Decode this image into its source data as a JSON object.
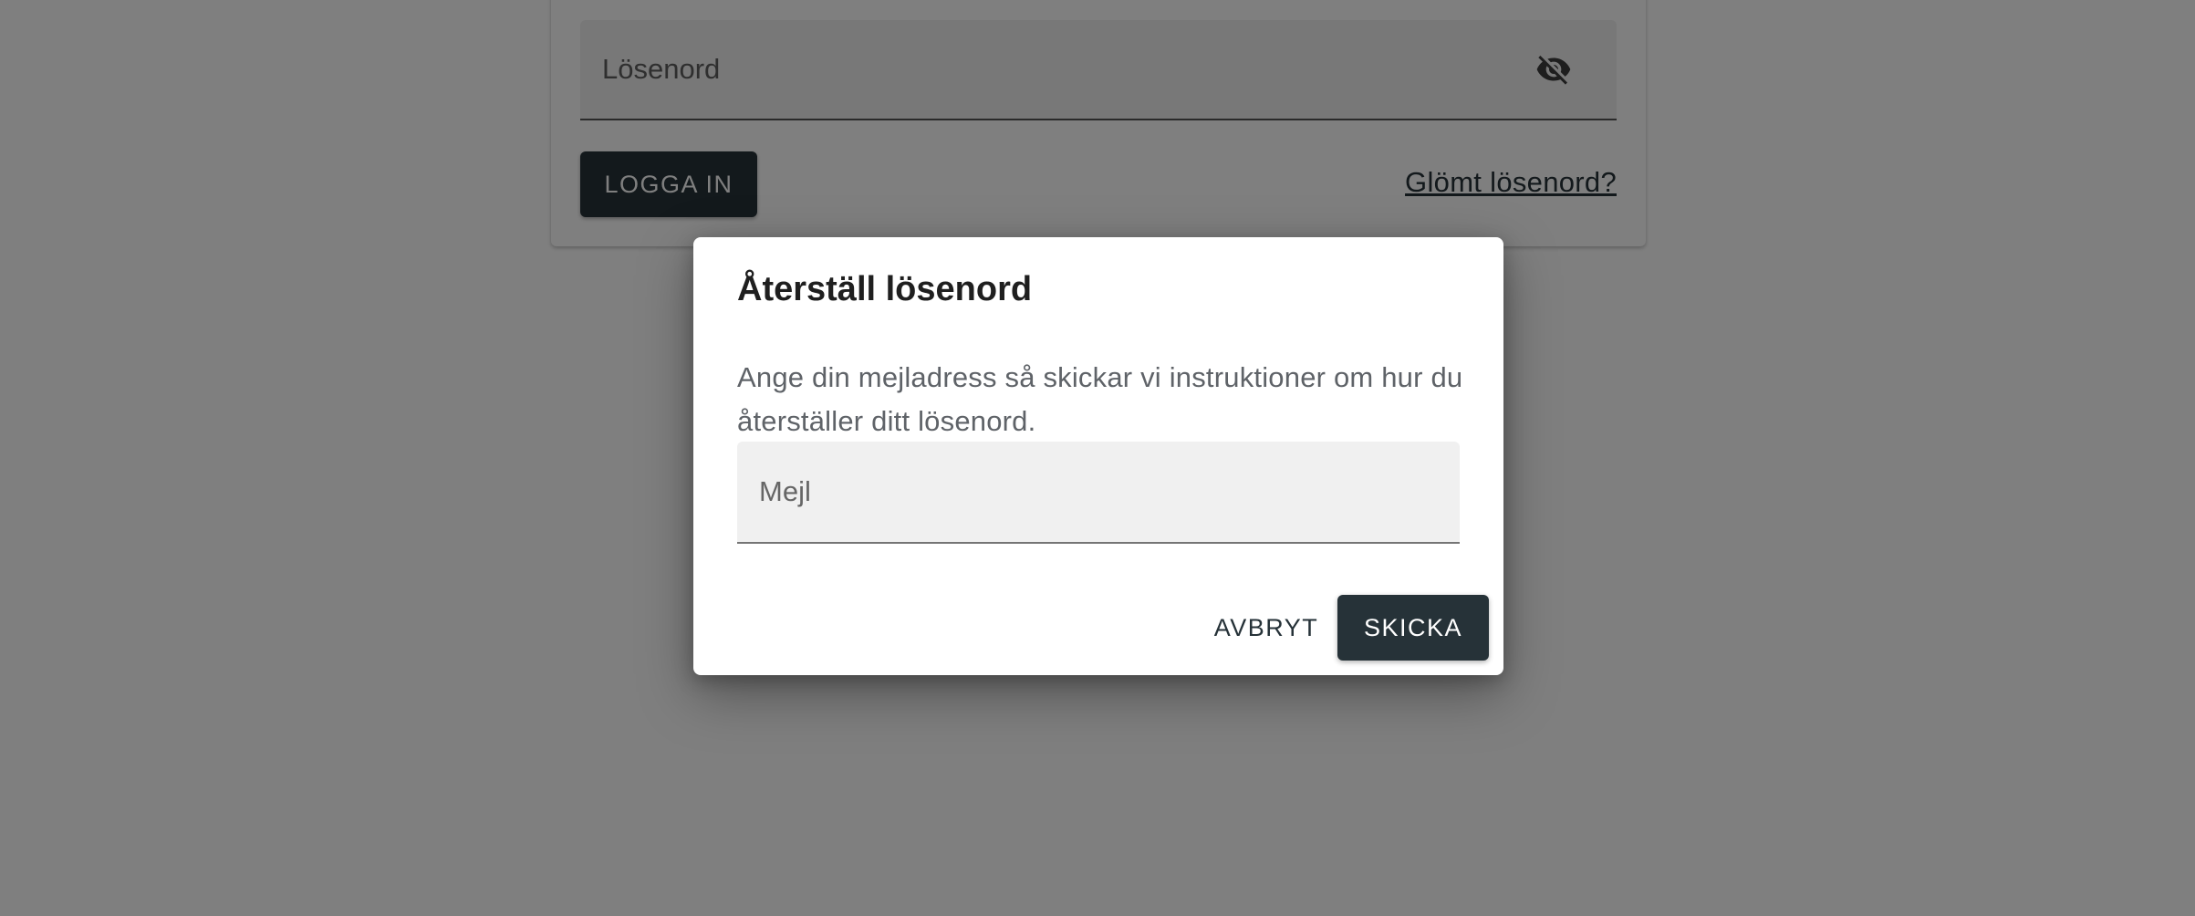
{
  "login": {
    "password_label": "Lösenord",
    "visibility_icon": "eye-off-icon",
    "login_button": "LOGGA IN",
    "forgot_link": "Glömt lösenord?"
  },
  "dialog": {
    "title": "Återställ lösenord",
    "text": "Ange din mejladress så skickar vi instruktioner om hur du återställer ditt lösenord.",
    "email_placeholder": "Mejl",
    "email_value": "",
    "cancel_button": "AVBRYT",
    "send_button": "SKICKA"
  },
  "colors": {
    "primary": "#263238",
    "field_background": "#f0f0f0",
    "scrim": "rgba(0,0,0,0.5)"
  }
}
